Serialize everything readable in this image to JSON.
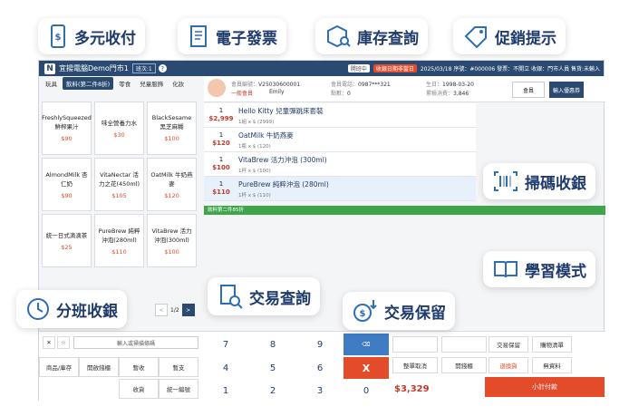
{
  "features": {
    "multi_pay": "多元收付",
    "e_invoice": "電子發票",
    "inventory": "庫存查詢",
    "promo": "促銷提示",
    "scan": "掃碼收銀",
    "learn": "學習模式",
    "shift": "分班收銀",
    "txn_query": "交易查詢",
    "hold": "交易保留"
  },
  "titlebar": {
    "logo": "N",
    "store": "宜揚電腦Demo門市1",
    "tag": "班次:1",
    "help": "?",
    "status": "開班中",
    "date_tag": "收銀日期非當日",
    "info": "2025/03/18 序號：#000006 發票：不開立 收銀：門市人員 售貨:未輸入"
  },
  "categories": [
    "玩具",
    "飲料(第二件8折)",
    "零食",
    "兒童服飾",
    "化妝"
  ],
  "products": [
    {
      "name": "FreshlySqueezed 鮮榨果汁",
      "price": "$90"
    },
    {
      "name": "味全營養力水",
      "price": "$30"
    },
    {
      "name": "BlackSesame 黑芝麻糊",
      "price": "$100"
    },
    {
      "name": "AlmondMilk 杏仁奶",
      "price": "$90"
    },
    {
      "name": "VitaNectar 活力之花(450ml)",
      "price": "$105"
    },
    {
      "name": "OatMilk 牛奶燕麥",
      "price": "$120"
    },
    {
      "name": "統一日式滴滴茶",
      "price": "$25"
    },
    {
      "name": "PureBrew 純粹沖泡(280ml)",
      "price": "$110"
    },
    {
      "name": "VitaBrew 活力沖泡(300ml)",
      "price": "$100"
    }
  ],
  "pager": {
    "prev": "<",
    "page": "1/2",
    "next": ">"
  },
  "member": {
    "id_label": "會員編號：",
    "id": "V25030600001",
    "type": "一般會員",
    "name": "Emily",
    "phone_label": "會員電話：",
    "phone": "0987***321",
    "points_label": "點數：",
    "points": "0",
    "birth_label": "生日：",
    "birth": "1998-03-20",
    "spent_label": "累積消費：",
    "spent": "3,846",
    "btn_member": "會員",
    "btn_enroll": "輸入優惠券"
  },
  "orders": [
    {
      "qty": "1",
      "amount": "$2,999",
      "name": "Hello Kitty 兒童彈跳床套裝",
      "detail": "1組 x $ (2999)"
    },
    {
      "qty": "1",
      "amount": "$120",
      "name": "OatMilk 牛奶燕麥",
      "detail": "1瓶 x $ (120)"
    },
    {
      "qty": "1",
      "amount": "$100",
      "name": "VitaBrew 活力沖泡 (300ml)",
      "detail": "1杯 x $ (100)"
    },
    {
      "qty": "1",
      "amount": "$110",
      "name": "PureBrew 純粹沖泡 (280ml)",
      "detail": "1杯 x $ (110)"
    }
  ],
  "promo_bar": "飲料第二件85折",
  "bottom": {
    "search_placeholder": "輸入或掃描條碼",
    "btn_stock": "商品/庫存",
    "btn_cashdrawer": "開啟錢櫃",
    "btn_pause": "暫收",
    "btn_pause2": "暫支",
    "btn_receive": "收貨",
    "btn_unify": "統一編號",
    "keys": [
      "7",
      "8",
      "9",
      "4",
      "5",
      "6",
      "1",
      "2",
      "3",
      "0"
    ],
    "clear": "X",
    "backspace": "⌫",
    "btn_hold": "交易保留",
    "btn_shop": "購物清單",
    "btn_cancel_all": "整單取消",
    "btn_open_drawer": "開錢櫃",
    "btn_return": "退換貨",
    "btn_no_sale": "無資料",
    "total": "$3,329",
    "checkout": "小計付款"
  }
}
